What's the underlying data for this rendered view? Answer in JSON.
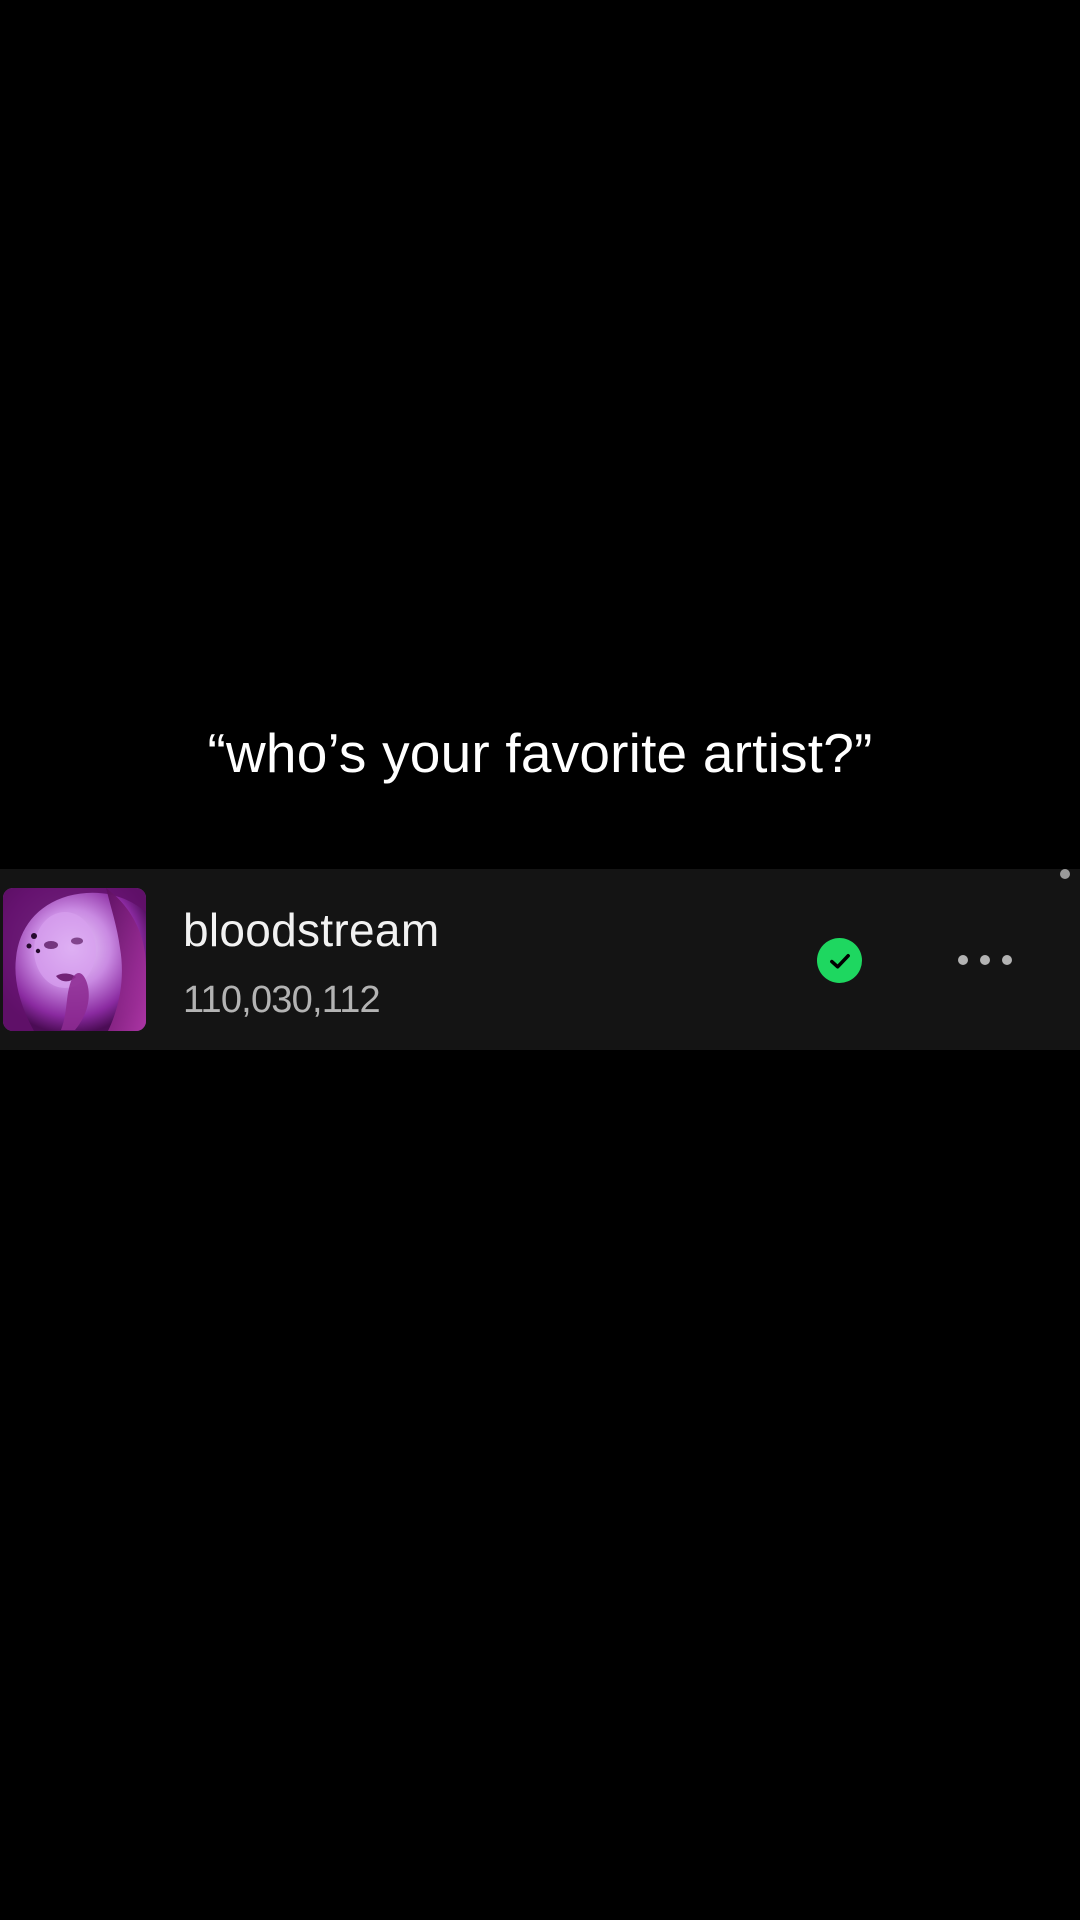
{
  "caption": {
    "text": "“who’s your favorite artist?”"
  },
  "track": {
    "title": "bloodstream",
    "plays": "110,030,112",
    "cover_icon": "album-cover-image",
    "download_icon": "downloaded-check-icon",
    "more_icon": "more-options-icon"
  },
  "colors": {
    "background": "#000000",
    "row_background": "#141414",
    "accent": "#1ed760",
    "primary_text": "#f2f2f2",
    "secondary_text": "#b3b3b3"
  }
}
